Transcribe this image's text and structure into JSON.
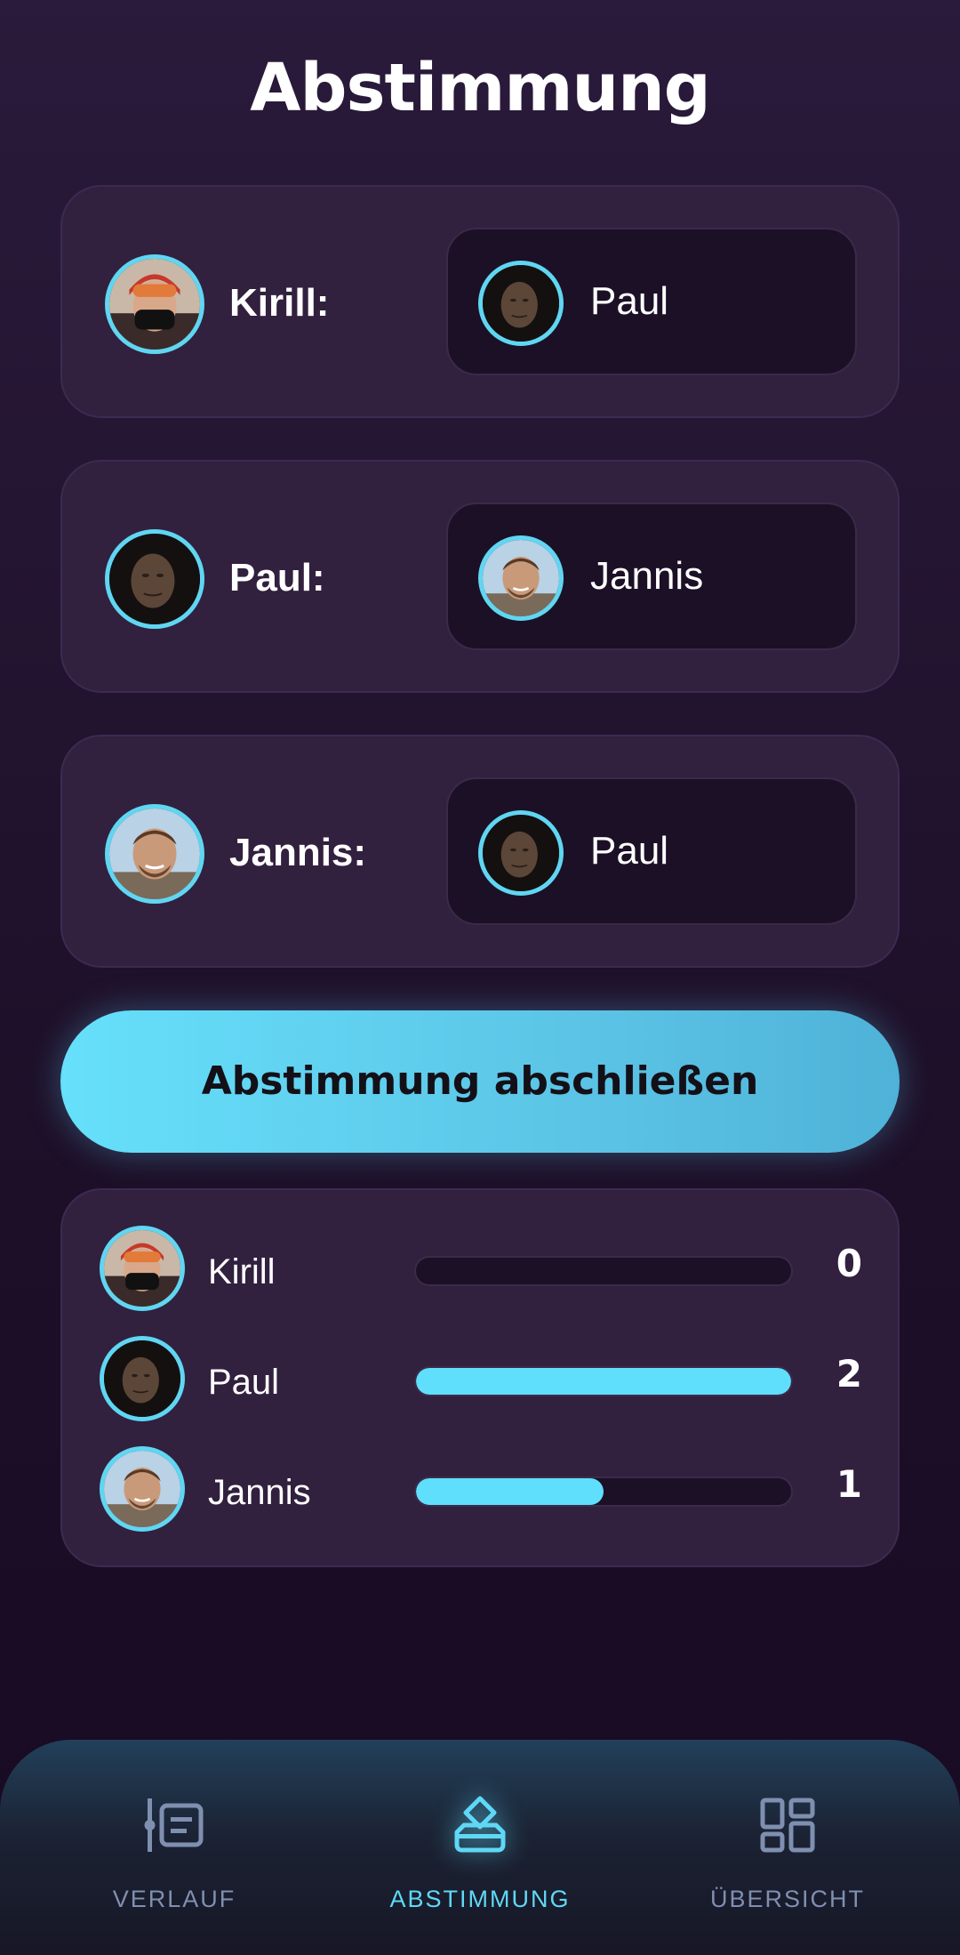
{
  "page": {
    "title": "Abstimmung"
  },
  "votes": [
    {
      "voter_label": "Kirill:",
      "choice": "Paul"
    },
    {
      "voter_label": "Paul:",
      "choice": "Jannis"
    },
    {
      "voter_label": "Jannis:",
      "choice": "Paul"
    }
  ],
  "finish_button": {
    "label": "Abstimmung abschließen"
  },
  "results": [
    {
      "name": "Kirill",
      "count": "0",
      "fraction": 0.0
    },
    {
      "name": "Paul",
      "count": "2",
      "fraction": 1.0
    },
    {
      "name": "Jannis",
      "count": "1",
      "fraction": 0.5
    }
  ],
  "nav": {
    "items": [
      {
        "label": "VERLAUF",
        "icon": "history-list-icon",
        "active": false
      },
      {
        "label": "ABSTIMMUNG",
        "icon": "ballot-box-icon",
        "active": true
      },
      {
        "label": "ÜBERSICHT",
        "icon": "dashboard-grid-icon",
        "active": false
      }
    ]
  },
  "colors": {
    "accent": "#5fd8f6",
    "background": "#1e1029",
    "card": "#32203f",
    "inset": "#1c1026",
    "nav_inactive": "#7f8fb0"
  }
}
